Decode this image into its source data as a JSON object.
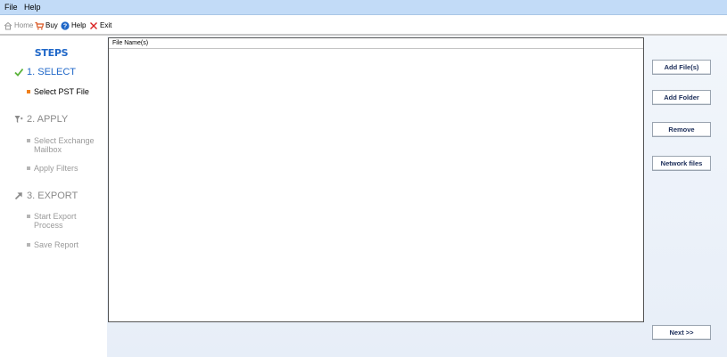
{
  "menu": {
    "file": "File",
    "help": "Help"
  },
  "toolbar": {
    "home": "Home",
    "buy": "Buy",
    "help": "Help",
    "exit": "Exit"
  },
  "sidebar": {
    "title": "STEPS",
    "steps": [
      {
        "label": "1. SELECT",
        "icon": "checkmark-icon",
        "color": "#1f67c8",
        "substeps": [
          "Select PST File"
        ]
      },
      {
        "label": "2. APPLY",
        "icon": "filter-icon",
        "color": "#8a8a8a",
        "substeps": [
          "Select Exchange Mailbox",
          "Apply Filters"
        ]
      },
      {
        "label": "3. EXPORT",
        "icon": "export-arrow-icon",
        "color": "#8a8a8a",
        "substeps": [
          "Start Export Process",
          "Save Report"
        ]
      }
    ]
  },
  "file_list": {
    "column_header": "File Name(s)",
    "rows": []
  },
  "actions": {
    "add_files": "Add File(s)",
    "add_folder": "Add Folder",
    "remove": "Remove",
    "network_files": "Network files",
    "next": "Next >>"
  },
  "colors": {
    "accent": "#1f67c8",
    "menubar": "#c2dbf7",
    "active_bullet": "#f0801c"
  }
}
